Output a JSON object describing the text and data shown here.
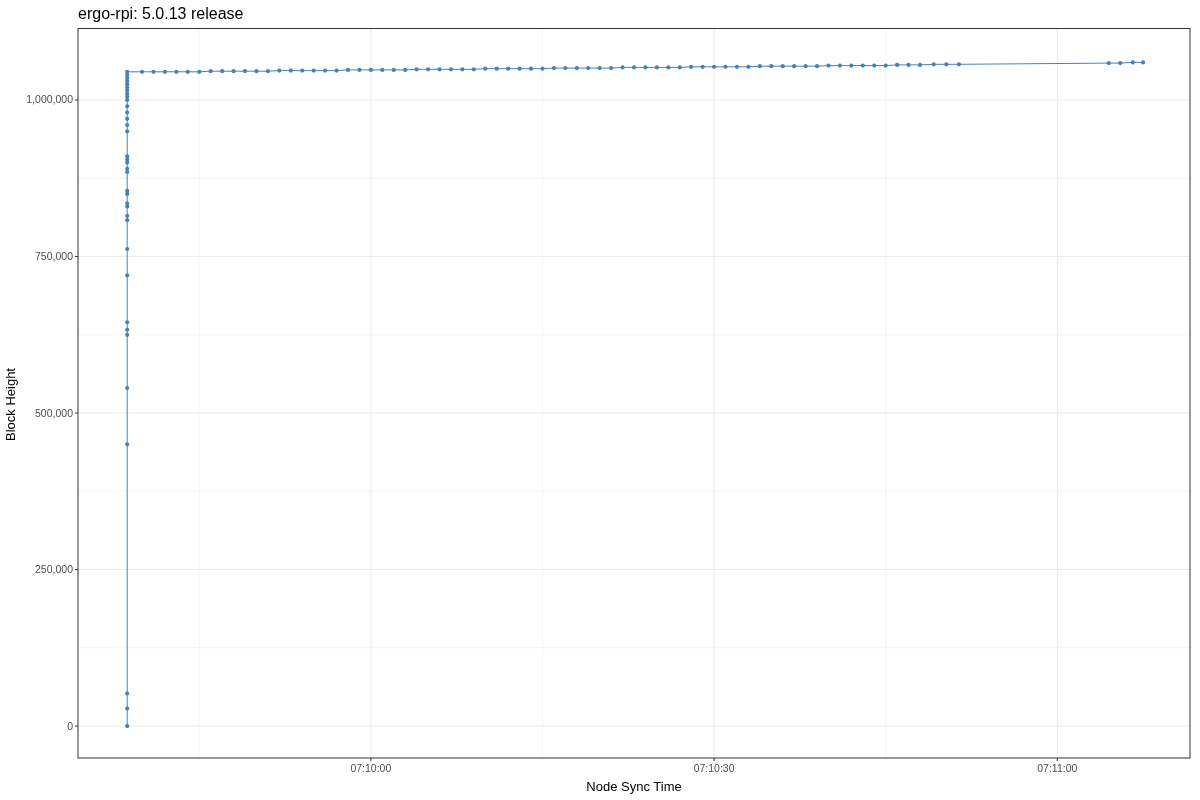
{
  "chart_data": {
    "type": "line",
    "title": "ergo-rpi: 5.0.13 release",
    "xlabel": "Node Sync Time",
    "ylabel": "Block Height",
    "x": [
      25778.7,
      25778.7,
      25778.7,
      25778.7,
      25778.7,
      25778.7,
      25778.7,
      25778.7,
      25778.7,
      25778.7,
      25778.7,
      25778.7,
      25778.7,
      25778.7,
      25778.7,
      25778.7,
      25778.7,
      25778.7,
      25778.7,
      25778.7,
      25778.7,
      25778.7,
      25778.7,
      25778.7,
      25778.7,
      25778.7,
      25778.7,
      25778.7,
      25778.7,
      25778.7,
      25778.7,
      25778.7,
      25778.7,
      25778.7,
      25778.7,
      25778.7,
      25780,
      25781,
      25782,
      25783,
      25784,
      25785,
      25786,
      25787,
      25788,
      25789,
      25790,
      25791,
      25792,
      25793,
      25794,
      25795,
      25796,
      25797,
      25798,
      25799,
      25800,
      25801,
      25802,
      25803,
      25804,
      25805,
      25806,
      25807,
      25808,
      25809,
      25810,
      25811,
      25812,
      25813,
      25814,
      25815,
      25816,
      25817,
      25818,
      25819,
      25820,
      25821,
      25822,
      25823,
      25824,
      25825,
      25826,
      25827,
      25828,
      25829,
      25830,
      25831,
      25832,
      25833,
      25834,
      25835,
      25836,
      25837,
      25838,
      25839,
      25840,
      25841,
      25842,
      25843,
      25844,
      25845,
      25846,
      25847,
      25848,
      25849.2,
      25850.3,
      25851.4,
      25864.5,
      25865.5,
      25866.6,
      25867.5
    ],
    "series": [
      {
        "color": "#4682b4",
        "values": [
          0,
          28000,
          52000,
          450000,
          540000,
          625000,
          633000,
          645000,
          720000,
          762000,
          808000,
          815000,
          830000,
          835000,
          850000,
          855000,
          885000,
          890000,
          900000,
          905000,
          910000,
          950000,
          960000,
          970000,
          980000,
          990000,
          1000000,
          1005000,
          1010000,
          1015000,
          1020000,
          1025000,
          1030000,
          1035000,
          1040000,
          1045000,
          1045000,
          1045000,
          1045000,
          1045000,
          1045000,
          1045000,
          1046000,
          1046000,
          1046000,
          1046000,
          1046000,
          1046000,
          1047000,
          1047000,
          1047000,
          1047000,
          1047000,
          1047000,
          1048000,
          1048000,
          1048000,
          1048000,
          1048000,
          1048000,
          1049000,
          1049000,
          1049000,
          1049000,
          1049000,
          1049000,
          1050000,
          1050000,
          1050000,
          1050000,
          1050000,
          1050000,
          1051000,
          1051000,
          1051000,
          1051000,
          1051000,
          1051000,
          1052000,
          1052000,
          1052000,
          1052000,
          1052000,
          1052000,
          1053000,
          1053000,
          1053000,
          1053000,
          1053000,
          1053000,
          1054000,
          1054000,
          1054000,
          1054000,
          1054000,
          1054000,
          1055000,
          1055000,
          1055000,
          1055000,
          1055000,
          1055000,
          1056000,
          1056000,
          1056000,
          1057000,
          1057000,
          1057000,
          1059000,
          1059000,
          1060000,
          1060000
        ]
      }
    ],
    "grid": true,
    "xlim": [
      25774.4,
      25871.6
    ],
    "ylim": [
      -51000,
      1115000
    ],
    "xticks": [
      {
        "value": 25800,
        "label": "07:10:00"
      },
      {
        "value": 25830,
        "label": "07:10:30"
      },
      {
        "value": 25860,
        "label": "07:11:00"
      }
    ],
    "yticks": [
      {
        "value": 0,
        "label": "0"
      },
      {
        "value": 250000,
        "label": "250,000"
      },
      {
        "value": 500000,
        "label": "500,000"
      },
      {
        "value": 750000,
        "label": "750,000"
      },
      {
        "value": 1000000,
        "label": "1,000,000"
      }
    ]
  }
}
